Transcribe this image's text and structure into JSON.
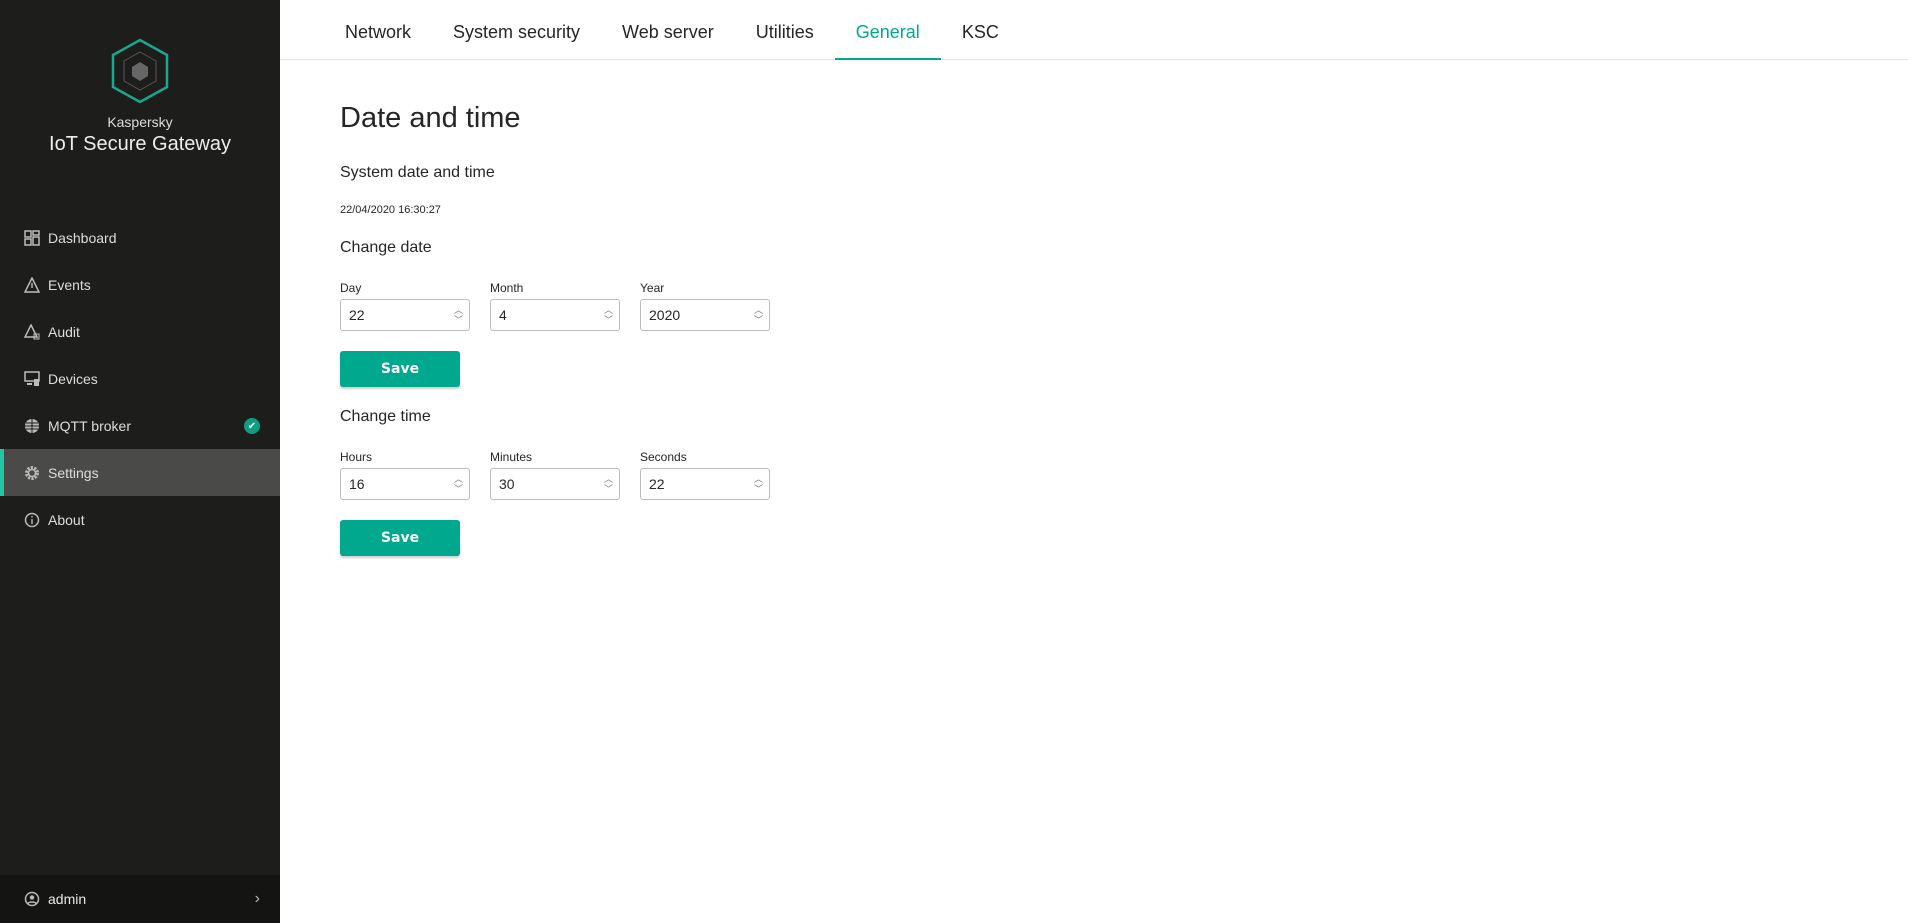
{
  "brand": {
    "company": "Kaspersky",
    "product": "IoT Secure Gateway"
  },
  "nav": [
    {
      "label": "Dashboard"
    },
    {
      "label": "Events"
    },
    {
      "label": "Audit"
    },
    {
      "label": "Devices"
    },
    {
      "label": "MQTT broker"
    },
    {
      "label": "Settings"
    },
    {
      "label": "About"
    }
  ],
  "user": "admin",
  "tabs": [
    "Network",
    "System security",
    "Web server",
    "Utilities",
    "General",
    "KSC"
  ],
  "page": {
    "title": "Date and time",
    "system_heading": "System date and time",
    "system_value": "22/04/2020 16:30:27",
    "change_date": "Change date",
    "day_label": "Day",
    "day": "22",
    "month_label": "Month",
    "month": "4",
    "year_label": "Year",
    "year": "2020",
    "save": "Save",
    "change_time": "Change time",
    "hours_label": "Hours",
    "hours": "16",
    "minutes_label": "Minutes",
    "minutes": "30",
    "seconds_label": "Seconds",
    "seconds": "22"
  },
  "colors": {
    "accent": "#00a88e",
    "sidebar": "#1d1d1b"
  }
}
